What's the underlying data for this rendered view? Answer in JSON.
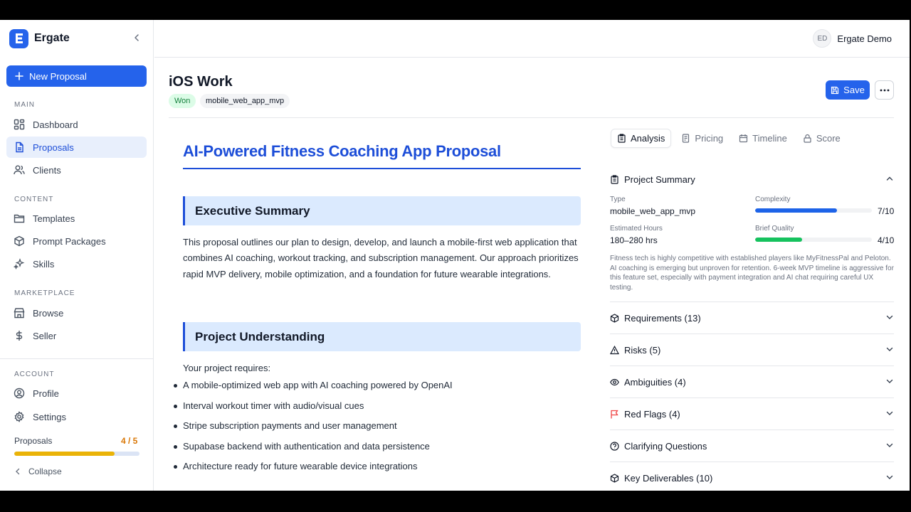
{
  "app": {
    "name": "Ergate"
  },
  "sidebar": {
    "new_button": "New Proposal",
    "sections": {
      "main": "MAIN",
      "content": "CONTENT",
      "marketplace": "MARKETPLACE",
      "account": "ACCOUNT"
    },
    "items": {
      "dashboard": "Dashboard",
      "proposals": "Proposals",
      "clients": "Clients",
      "templates": "Templates",
      "prompt_packages": "Prompt Packages",
      "skills": "Skills",
      "browse": "Browse",
      "seller": "Seller",
      "profile": "Profile",
      "settings": "Settings"
    },
    "active_item": "Proposals",
    "quota": {
      "label": "Proposals",
      "value": "4 / 5",
      "fraction": 0.8
    },
    "collapse_label": "Collapse"
  },
  "header": {
    "user_initials": "ED",
    "user_name": "Ergate Demo"
  },
  "page": {
    "title": "iOS Work",
    "status_badge": "Won",
    "type_badge": "mobile_web_app_mvp",
    "save_label": "Save"
  },
  "document": {
    "title": "AI-Powered Fitness Coaching App Proposal",
    "sections": [
      {
        "heading": "Executive Summary",
        "body": "This proposal outlines our plan to design, develop, and launch a mobile-first web application that combines AI coaching, workout tracking, and subscription management. Our approach prioritizes rapid MVP delivery, mobile optimization, and a foundation for future wearable integrations."
      },
      {
        "heading": "Project Understanding",
        "intro": "Your project requires:",
        "bullets": [
          "A mobile-optimized web app with AI coaching powered by OpenAI",
          "Interval workout timer with audio/visual cues",
          "Stripe subscription payments and user management",
          "Supabase backend with authentication and data persistence",
          "Architecture ready for future wearable device integrations"
        ]
      }
    ]
  },
  "panel": {
    "tabs": [
      "Analysis",
      "Pricing",
      "Timeline",
      "Score"
    ],
    "active_tab": "Analysis",
    "summary": {
      "title": "Project Summary",
      "type_label": "Type",
      "type_value": "mobile_web_app_mvp",
      "complexity_label": "Complexity",
      "complexity_value": "7/10",
      "complexity_score": 7,
      "hours_label": "Estimated Hours",
      "hours_value": "180–280 hrs",
      "quality_label": "Brief Quality",
      "quality_value": "4/10",
      "quality_score": 4,
      "note": "Fitness tech is highly competitive with established players like MyFitnessPal and Peloton. AI coaching is emerging but unproven for retention. 6-week MVP timeline is aggressive for this feature set, especially with payment integration and AI chat requiring careful UX testing."
    },
    "sections": [
      {
        "label": "Requirements (13)",
        "icon": "cube-icon"
      },
      {
        "label": "Risks (5)",
        "icon": "warning-icon"
      },
      {
        "label": "Ambiguities (4)",
        "icon": "eye-icon"
      },
      {
        "label": "Red Flags (4)",
        "icon": "flag-icon"
      },
      {
        "label": "Clarifying Questions",
        "icon": "question-icon"
      },
      {
        "label": "Key Deliverables (10)",
        "icon": "cube-icon"
      }
    ]
  },
  "colors": {
    "accent": "#2563eb",
    "complexity_bar": "#1d63e8",
    "quality_bar": "#16c25e",
    "quota_bar": "#eab308",
    "won_badge": "#dcfce7",
    "red_flag": "#ef4444"
  }
}
